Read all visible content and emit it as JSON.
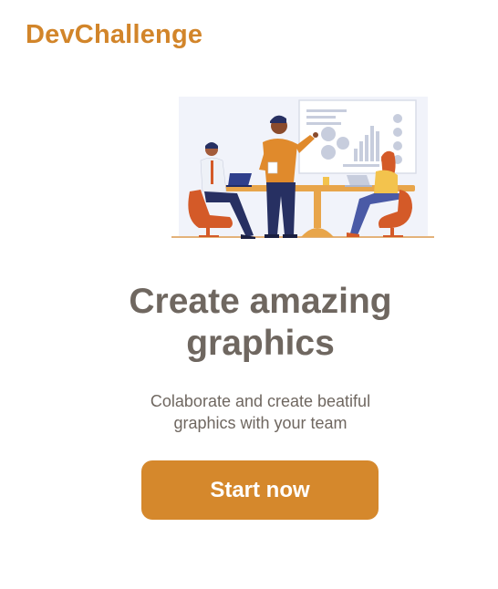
{
  "header": {
    "brand": "DevChallenge"
  },
  "hero": {
    "illustration_icon": "team-presentation-illustration"
  },
  "main": {
    "title_line1": "Create amazing",
    "title_line2": "graphics",
    "subtitle_line1": "Colaborate and create beatiful",
    "subtitle_line2": "graphics with your team",
    "cta_label": "Start now"
  },
  "colors": {
    "brand": "#d2852a",
    "button": "#d5882c",
    "text": "#6f6760",
    "background": "#ffffff"
  }
}
